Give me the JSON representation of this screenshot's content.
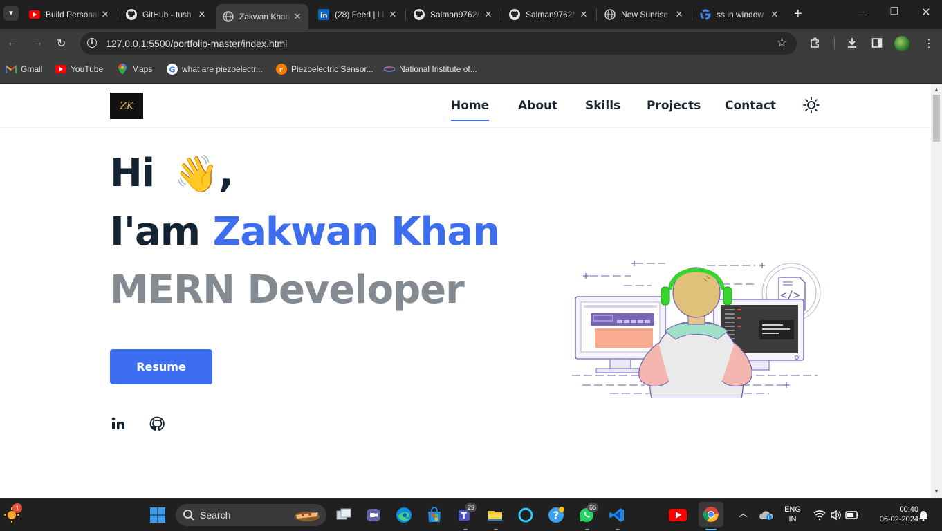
{
  "browser": {
    "tabs": [
      {
        "title": "Build Personal",
        "icon": "youtube-icon",
        "active": false
      },
      {
        "title": "GitHub - tush",
        "icon": "github-icon",
        "active": false
      },
      {
        "title": "Zakwan Khan",
        "icon": "globe-icon",
        "active": true
      },
      {
        "title": "(28) Feed | Li",
        "icon": "linkedin-icon",
        "active": false
      },
      {
        "title": "Salman9762/",
        "icon": "github-icon",
        "active": false
      },
      {
        "title": "Salman9762/",
        "icon": "github-icon",
        "active": false
      },
      {
        "title": "New Sunrise",
        "icon": "globe-icon",
        "active": false
      },
      {
        "title": "ss in window",
        "icon": "google-icon",
        "active": false
      }
    ],
    "url": "127.0.0.1:5500/portfolio-master/index.html",
    "bookmarks": [
      {
        "label": "Gmail",
        "icon": "gmail-icon"
      },
      {
        "label": "YouTube",
        "icon": "youtube-icon"
      },
      {
        "label": "Maps",
        "icon": "maps-icon"
      },
      {
        "label": "what are piezoelectr...",
        "icon": "google-icon"
      },
      {
        "label": "Piezoelectric Sensor...",
        "icon": "site-icon"
      },
      {
        "label": "National Institute of...",
        "icon": "site-icon"
      }
    ]
  },
  "site": {
    "logo_text": "ZK",
    "nav": [
      {
        "label": "Home",
        "active": true
      },
      {
        "label": "About",
        "active": false
      },
      {
        "label": "Skills",
        "active": false
      },
      {
        "label": "Projects",
        "active": false
      },
      {
        "label": "Contact",
        "active": false
      }
    ],
    "hero": {
      "greeting": "Hi",
      "wave": "👋",
      "comma": ",",
      "iam": "I'am",
      "name": "Zakwan Khan",
      "role": "MERN Developer"
    },
    "resume_label": "Resume",
    "social": [
      "linkedin-icon",
      "github-icon"
    ],
    "accent_color": "#3d6ef0"
  },
  "taskbar": {
    "search_placeholder": "Search",
    "notification_count": "1",
    "badges": {
      "teams": "29",
      "whatsapp": "65"
    },
    "language": "ENG",
    "region": "IN",
    "time": "00:40",
    "date": "06-02-2024"
  }
}
